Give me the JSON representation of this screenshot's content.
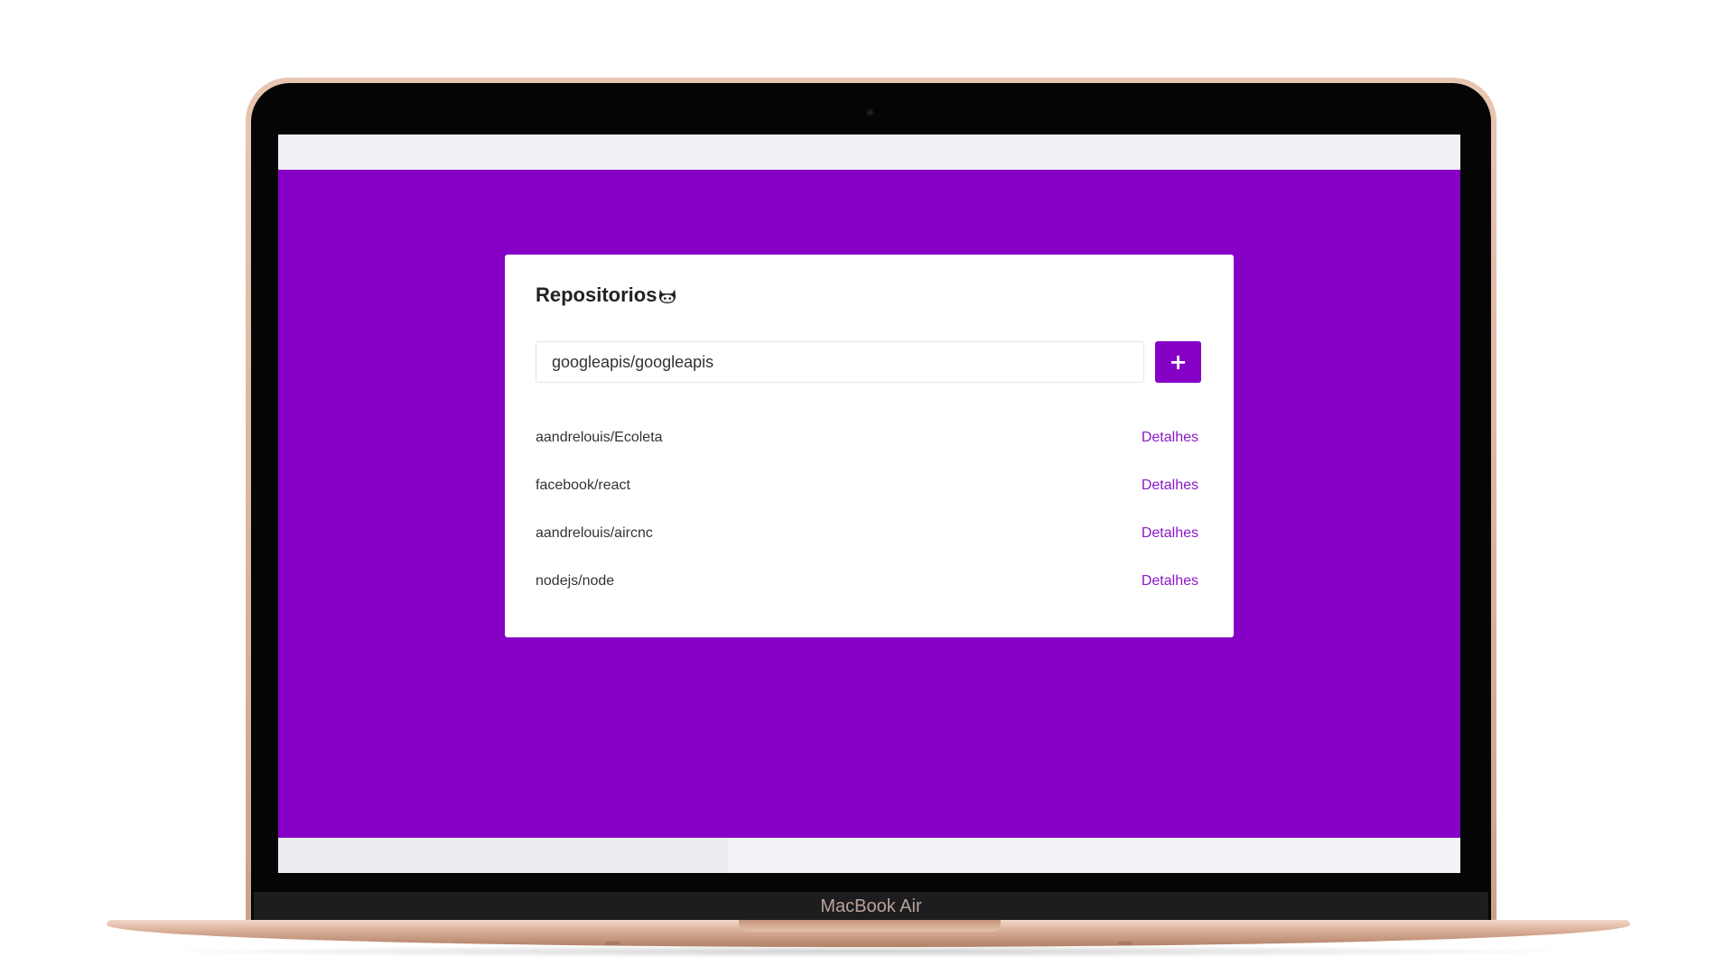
{
  "device": {
    "brand_label": "MacBook Air"
  },
  "app": {
    "title": "Repositorios",
    "title_icon": "octocat-icon",
    "accent_color": "#8700c6",
    "search": {
      "value": "googleapis/googleapis",
      "placeholder": ""
    },
    "add_button_label": "+",
    "repositories": [
      {
        "name": "aandrelouis/Ecoleta",
        "link_label": "Detalhes"
      },
      {
        "name": "facebook/react",
        "link_label": "Detalhes"
      },
      {
        "name": "aandrelouis/aircnc",
        "link_label": "Detalhes"
      },
      {
        "name": "nodejs/node",
        "link_label": "Detalhes"
      }
    ]
  }
}
